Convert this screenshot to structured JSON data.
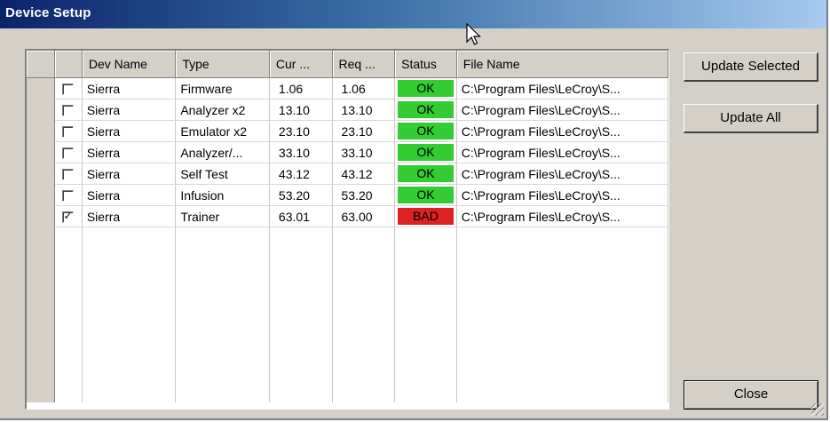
{
  "window": {
    "title": "Device Setup"
  },
  "table": {
    "columns": [
      "Dev Name",
      "Type",
      "Cur ...",
      "Req ...",
      "Status",
      "File Name"
    ],
    "rows": [
      {
        "checked": false,
        "dev_name": "Sierra",
        "type": "Firmware",
        "cur": "1.06",
        "req": "1.06",
        "status": "OK",
        "file": "C:\\Program Files\\LeCroy\\S..."
      },
      {
        "checked": false,
        "dev_name": "Sierra",
        "type": "Analyzer x2",
        "cur": "13.10",
        "req": "13.10",
        "status": "OK",
        "file": "C:\\Program Files\\LeCroy\\S..."
      },
      {
        "checked": false,
        "dev_name": "Sierra",
        "type": "Emulator x2",
        "cur": "23.10",
        "req": "23.10",
        "status": "OK",
        "file": "C:\\Program Files\\LeCroy\\S..."
      },
      {
        "checked": false,
        "dev_name": "Sierra",
        "type": "Analyzer/...",
        "cur": "33.10",
        "req": "33.10",
        "status": "OK",
        "file": "C:\\Program Files\\LeCroy\\S..."
      },
      {
        "checked": false,
        "dev_name": "Sierra",
        "type": "Self Test",
        "cur": "43.12",
        "req": "43.12",
        "status": "OK",
        "file": "C:\\Program Files\\LeCroy\\S..."
      },
      {
        "checked": false,
        "dev_name": "Sierra",
        "type": "Infusion",
        "cur": "53.20",
        "req": "53.20",
        "status": "OK",
        "file": "C:\\Program Files\\LeCroy\\S..."
      },
      {
        "checked": true,
        "dev_name": "Sierra",
        "type": "Trainer",
        "cur": "63.01",
        "req": "63.00",
        "status": "BAD",
        "file": "C:\\Program Files\\LeCroy\\S..."
      }
    ]
  },
  "buttons": {
    "update_selected": "Update Selected",
    "update_all": "Update All",
    "close": "Close"
  },
  "colors": {
    "ok": "#33cc33",
    "bad": "#dd2222",
    "title_start": "#0a246a",
    "title_end": "#a6caf0"
  },
  "icons": {
    "cursor": "mouse-pointer-icon",
    "grip": "resize-grip-icon"
  }
}
